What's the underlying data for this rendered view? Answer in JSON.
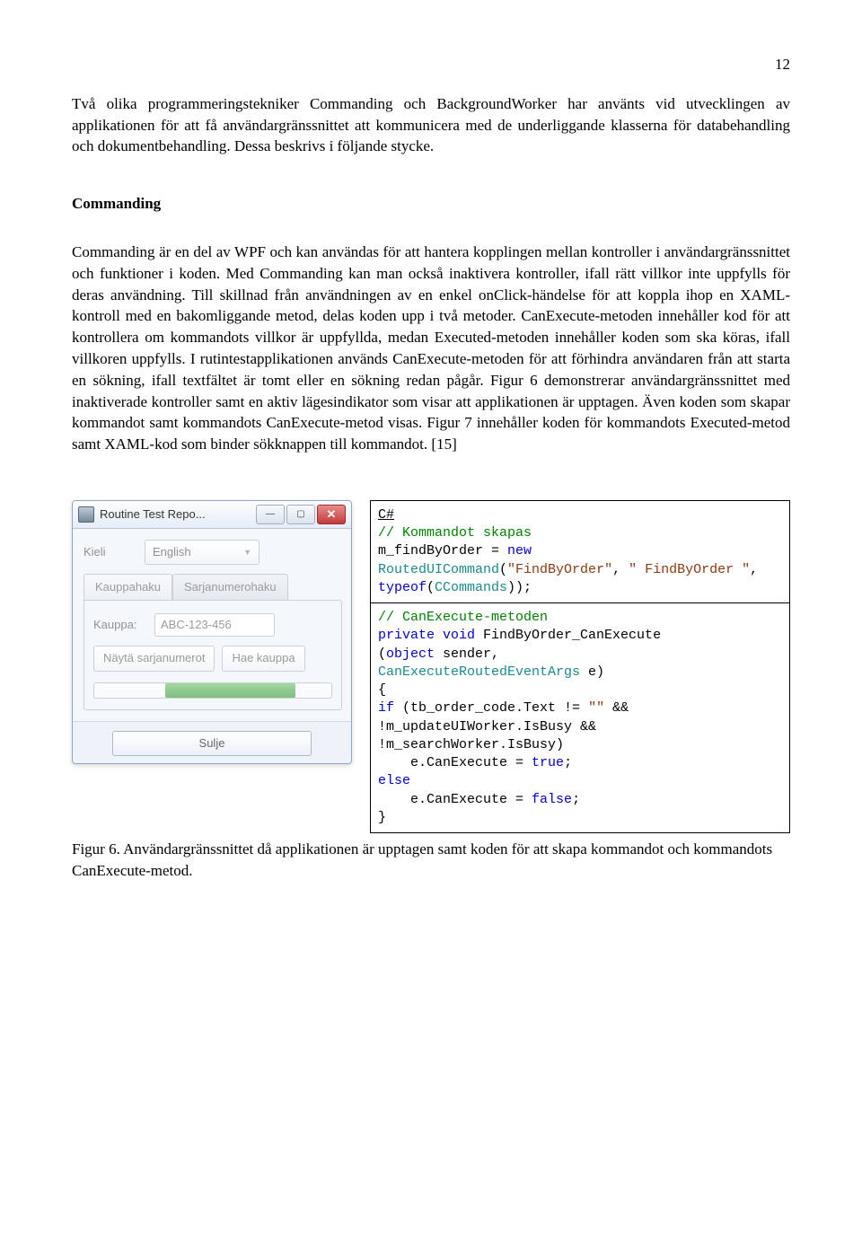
{
  "page_number": "12",
  "para1": "Två olika programmeringstekniker Commanding och BackgroundWorker har använts vid utvecklingen av applikationen för att få användargränssnittet att kommunicera med de underliggande klasserna för databehandling och dokumentbehandling. Dessa beskrivs i följande stycke.",
  "heading": "Commanding",
  "para2": "Commanding är en del av WPF och kan användas för att hantera kopplingen mellan kontroller i användargränssnittet och funktioner i koden. Med Commanding kan man också inaktivera kontroller, ifall rätt villkor inte uppfylls för deras användning. Till skillnad från användningen av en enkel onClick-händelse för att koppla ihop en XAML-kontroll med en bakomliggande metod, delas koden upp i två metoder. CanExecute-metoden innehåller kod för att kontrollera om kommandots villkor är uppfyllda, medan Executed-metoden innehåller koden som ska köras, ifall villkoren uppfylls. I rutintestapplikationen används CanExecute-metoden för att förhindra användaren från att starta en sökning, ifall textfältet är tomt eller en sökning redan pågår. Figur 6 demonstrerar användargränssnittet med inaktiverade kontroller samt en aktiv lägesindikator som visar att applikationen är upptagen. Även koden som skapar kommandot samt kommandots CanExecute-metod visas. Figur 7 innehåller koden för kommandots Executed-metod samt XAML-kod som binder sökknappen till kommandot. [15]",
  "window": {
    "title": "Routine Test Repo...",
    "lang_label": "Kieli",
    "lang_value": "English",
    "tab1": "Kauppahaku",
    "tab2": "Sarjanumerohaku",
    "field_label": "Kauppa:",
    "field_value": "ABC-123-456",
    "btn1": "Näytä sarjanumerot",
    "btn2": "Hae kauppa",
    "close": "Sulje"
  },
  "code": {
    "lang": "C#",
    "c1_comment": "// Kommandot skapas",
    "c1_l1a": "m_findByOrder = ",
    "c1_l1b": "new",
    "c1_l2a": "RoutedUICommand",
    "c1_l2b": "(",
    "c1_l2c": "\"FindByOrder\"",
    "c1_l2d": ", ",
    "c1_l2e": "\" FindByOrder \"",
    "c1_l2f": ", ",
    "c1_l2g": "typeof",
    "c1_l2h": "(",
    "c1_l2i": "CCommands",
    "c1_l2j": "));",
    "c2_comment": "// CanExecute-metoden",
    "c2_l1a": "private void",
    "c2_l1b": " FindByOrder_CanExecute",
    "c2_l2a": "(",
    "c2_l2b": "object",
    "c2_l2c": " sender,",
    "c2_l3a": "CanExecuteRoutedEventArgs",
    "c2_l3b": " e)",
    "c2_l4": "{",
    "c2_l5a": "if",
    "c2_l5b": " (tb_order_code.Text != ",
    "c2_l5c": "\"\"",
    "c2_l5d": " && !m_updateUIWorker.IsBusy && !m_searchWorker.IsBusy)",
    "c2_l6a": "    e.CanExecute = ",
    "c2_l6b": "true",
    "c2_l6c": ";",
    "c2_l7": "else",
    "c2_l8a": "    e.CanExecute = ",
    "c2_l8b": "false",
    "c2_l8c": ";",
    "c2_l9": "}"
  },
  "caption": "Figur 6. Användargränssnittet då applikationen är upptagen samt koden för att skapa kommandot och kommandots CanExecute-metod."
}
